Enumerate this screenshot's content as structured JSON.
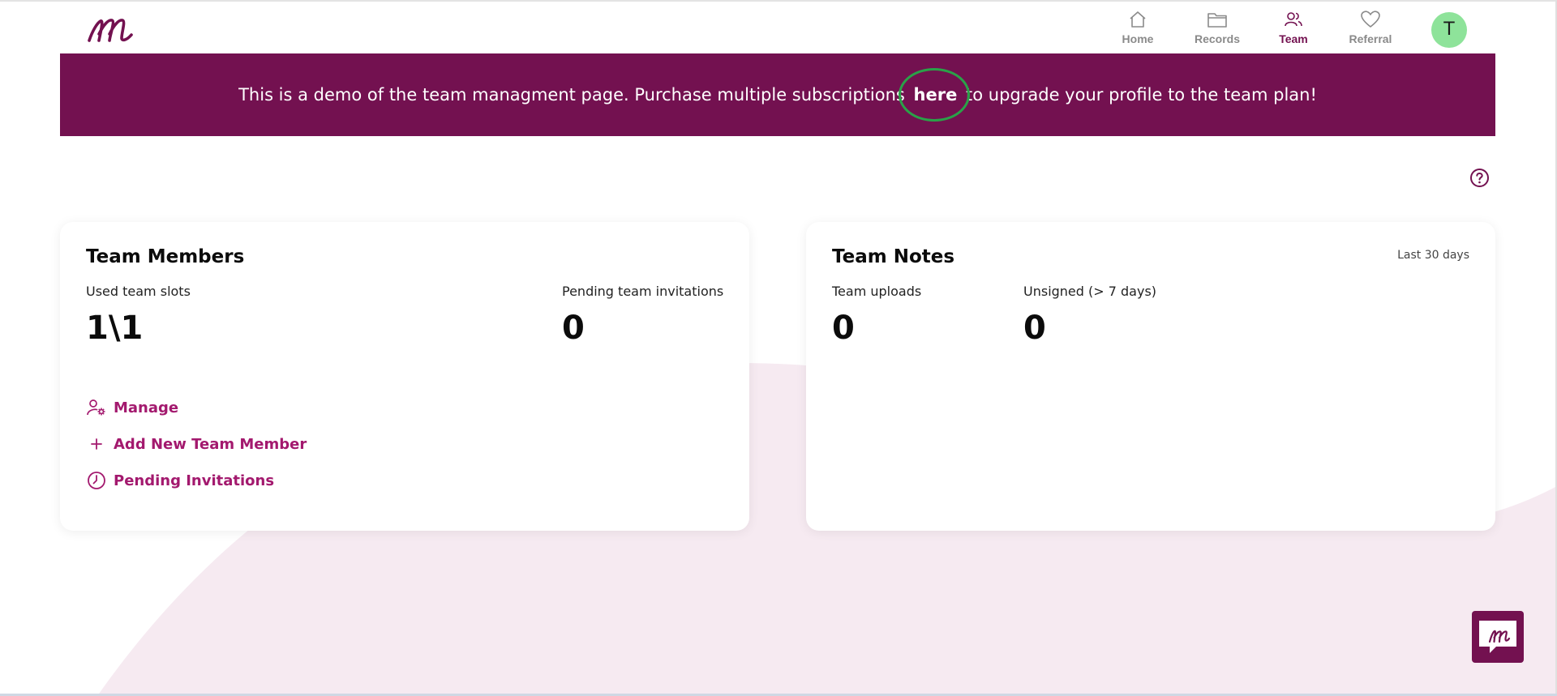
{
  "nav": {
    "items": [
      {
        "label": "Home",
        "icon": "home-icon"
      },
      {
        "label": "Records",
        "icon": "folder-icon"
      },
      {
        "label": "Team",
        "icon": "team-icon"
      },
      {
        "label": "Referral",
        "icon": "heart-icon"
      }
    ],
    "avatar_initial": "T"
  },
  "banner": {
    "text_before": "This is a demo of the team managment page. Purchase multiple subscriptions",
    "link_text": "here",
    "text_after": "to upgrade your profile to the team plan!"
  },
  "team_members": {
    "title": "Team Members",
    "used_slots_label": "Used team slots",
    "used_slots_value": "1\\1",
    "pending_label": "Pending team invitations",
    "pending_value": "0",
    "actions": [
      "Manage",
      "Add New Team Member",
      "Pending Invitations"
    ]
  },
  "team_notes": {
    "title": "Team Notes",
    "period": "Last 30 days",
    "uploads_label": "Team uploads",
    "uploads_value": "0",
    "unsigned_label": "Unsigned (> 7 days)",
    "unsigned_value": "0"
  },
  "colors": {
    "brand": "#731150",
    "accent_link": "#a3196e",
    "avatar": "#8ee39a",
    "highlight": "#2aa148"
  }
}
